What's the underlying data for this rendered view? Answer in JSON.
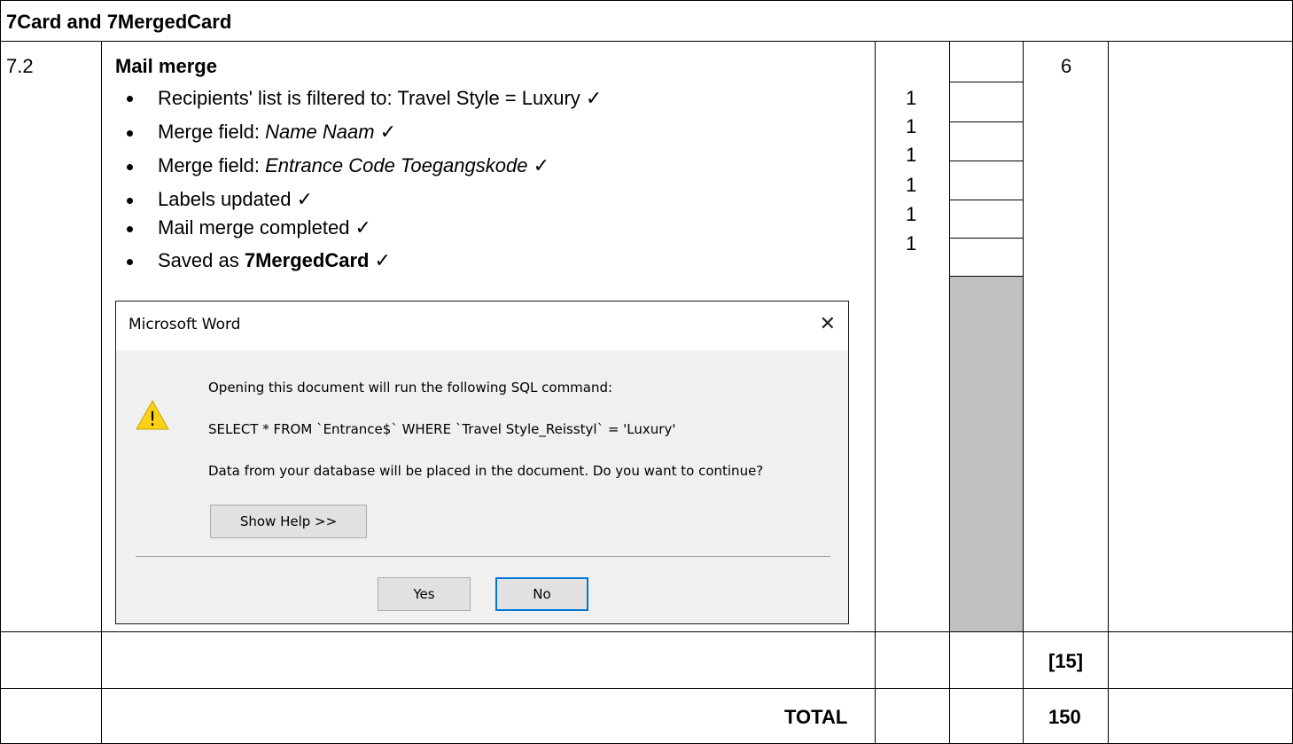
{
  "section_header": "7Card and 7MergedCard",
  "question": {
    "number": "7.2",
    "title": "Mail merge",
    "max_mark": "6",
    "items": [
      {
        "prefix": "Recipients' list is filtered to: Travel Style = Luxury ",
        "italic": "",
        "bold": "",
        "check": "✓",
        "mark": "1"
      },
      {
        "prefix": "Merge field:  ",
        "italic": "Name Naam",
        "bold": "",
        "check": " ✓",
        "mark": "1"
      },
      {
        "prefix": "Merge field:  ",
        "italic": "Entrance Code Toegangskode",
        "bold": "",
        "check": " ✓",
        "mark": "1"
      },
      {
        "prefix": "Labels updated ",
        "italic": "",
        "bold": "",
        "check": "✓",
        "mark": "1"
      },
      {
        "prefix": "Mail merge completed ",
        "italic": "",
        "bold": "",
        "check": "✓",
        "mark": "1"
      },
      {
        "prefix": "Saved as ",
        "italic": "",
        "bold": "7MergedCard",
        "check": " ✓",
        "mark": "1"
      }
    ]
  },
  "dialog": {
    "title": "Microsoft Word",
    "close_glyph": "✕",
    "warning_glyph": "!",
    "line1": "Opening this document will run the following SQL command:",
    "line2": "SELECT * FROM `Entrance$` WHERE `Travel Style_Reisstyl` = 'Luxury'",
    "line3": "Data from your database will be placed in the document. Do you want to continue?",
    "show_help": "Show Help >>",
    "yes": "Yes",
    "no": "No"
  },
  "subtotal": "[15]",
  "total_label": "TOTAL",
  "total_value": "150"
}
